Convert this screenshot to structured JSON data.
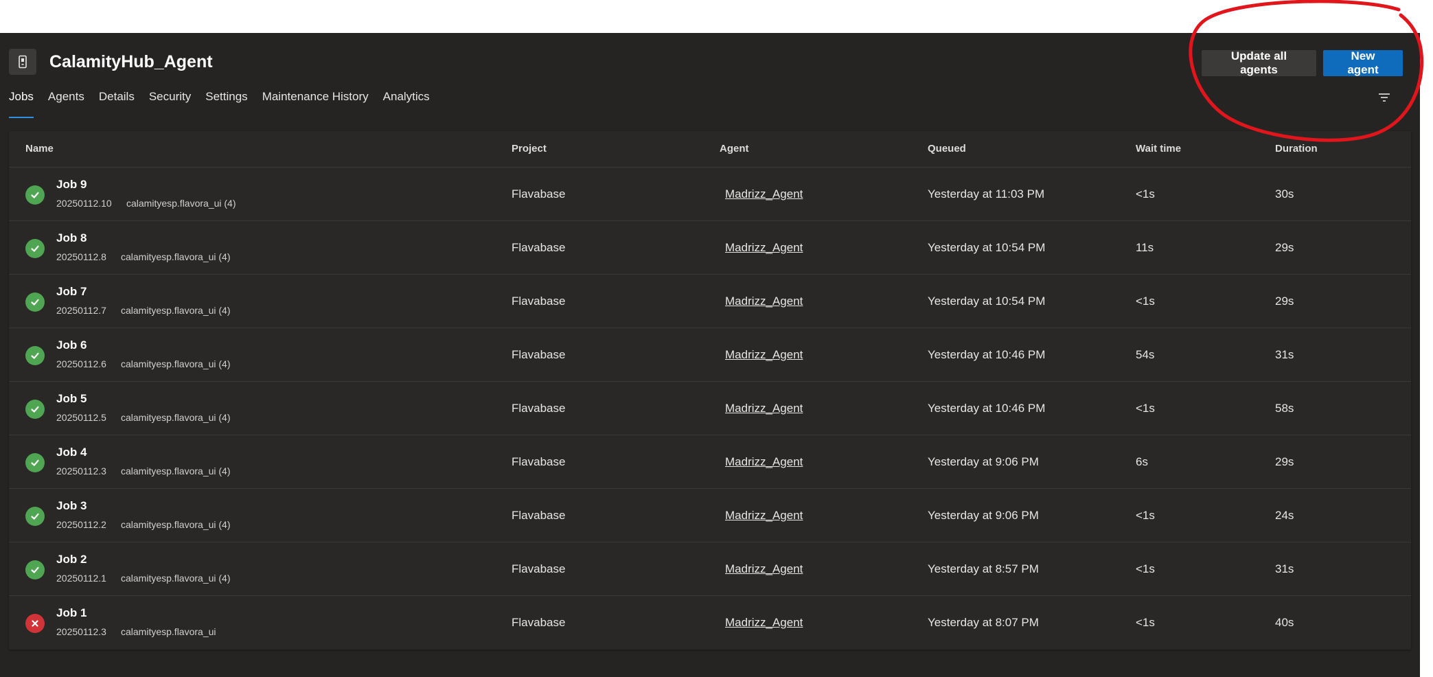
{
  "header": {
    "title": "CalamityHub_Agent",
    "icon": "agent-pool-icon"
  },
  "buttons": {
    "update_all": "Update all agents",
    "new_agent": "New agent"
  },
  "tabs": [
    {
      "label": "Jobs",
      "active": true
    },
    {
      "label": "Agents",
      "active": false
    },
    {
      "label": "Details",
      "active": false
    },
    {
      "label": "Security",
      "active": false
    },
    {
      "label": "Settings",
      "active": false
    },
    {
      "label": "Maintenance History",
      "active": false
    },
    {
      "label": "Analytics",
      "active": false
    }
  ],
  "columns": {
    "name": "Name",
    "project": "Project",
    "agent": "Agent",
    "queued": "Queued",
    "wait": "Wait time",
    "duration": "Duration"
  },
  "rows": [
    {
      "status": "success",
      "name": "Job 9",
      "build": "20250112.10",
      "pipeline": "calamityesp.flavora_ui (4)",
      "project": "Flavabase",
      "agent": "Madrizz_Agent",
      "queued": "Yesterday at 11:03 PM",
      "wait": "<1s",
      "duration": "30s"
    },
    {
      "status": "success",
      "name": "Job 8",
      "build": "20250112.8",
      "pipeline": "calamityesp.flavora_ui (4)",
      "project": "Flavabase",
      "agent": "Madrizz_Agent",
      "queued": "Yesterday at 10:54 PM",
      "wait": "11s",
      "duration": "29s"
    },
    {
      "status": "success",
      "name": "Job 7",
      "build": "20250112.7",
      "pipeline": "calamityesp.flavora_ui (4)",
      "project": "Flavabase",
      "agent": "Madrizz_Agent",
      "queued": "Yesterday at 10:54 PM",
      "wait": "<1s",
      "duration": "29s"
    },
    {
      "status": "success",
      "name": "Job 6",
      "build": "20250112.6",
      "pipeline": "calamityesp.flavora_ui (4)",
      "project": "Flavabase",
      "agent": "Madrizz_Agent",
      "queued": "Yesterday at 10:46 PM",
      "wait": "54s",
      "duration": "31s"
    },
    {
      "status": "success",
      "name": "Job 5",
      "build": "20250112.5",
      "pipeline": "calamityesp.flavora_ui (4)",
      "project": "Flavabase",
      "agent": "Madrizz_Agent",
      "queued": "Yesterday at 10:46 PM",
      "wait": "<1s",
      "duration": "58s"
    },
    {
      "status": "success",
      "name": "Job 4",
      "build": "20250112.3",
      "pipeline": "calamityesp.flavora_ui (4)",
      "project": "Flavabase",
      "agent": "Madrizz_Agent",
      "queued": "Yesterday at 9:06 PM",
      "wait": "6s",
      "duration": "29s"
    },
    {
      "status": "success",
      "name": "Job 3",
      "build": "20250112.2",
      "pipeline": "calamityesp.flavora_ui (4)",
      "project": "Flavabase",
      "agent": "Madrizz_Agent",
      "queued": "Yesterday at 9:06 PM",
      "wait": "<1s",
      "duration": "24s"
    },
    {
      "status": "success",
      "name": "Job 2",
      "build": "20250112.1",
      "pipeline": "calamityesp.flavora_ui (4)",
      "project": "Flavabase",
      "agent": "Madrizz_Agent",
      "queued": "Yesterday at 8:57 PM",
      "wait": "<1s",
      "duration": "31s"
    },
    {
      "status": "failed",
      "name": "Job 1",
      "build": "20250112.3",
      "pipeline": "calamityesp.flavora_ui",
      "project": "Flavabase",
      "agent": "Madrizz_Agent",
      "queued": "Yesterday at 8:07 PM",
      "wait": "<1s",
      "duration": "40s"
    }
  ],
  "colors": {
    "background": "#252423",
    "primary": "#0f6cbd",
    "success": "#4fa551",
    "failed": "#d13438",
    "annotation": "#e0161c"
  }
}
